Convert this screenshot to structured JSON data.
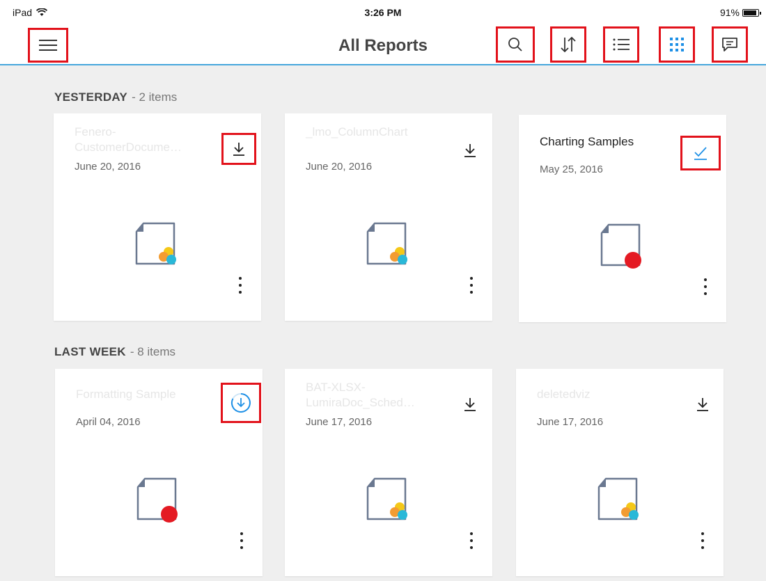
{
  "status_bar": {
    "device": "iPad",
    "time": "3:26 PM",
    "battery": "91%",
    "battery_level": 0.91
  },
  "nav": {
    "title": "All Reports"
  },
  "sections": [
    {
      "title": "YESTERDAY",
      "count": "- 2 items",
      "cards": [
        {
          "title": "Fenero-\nCustomerDocume…",
          "date": "June 20, 2016",
          "action": "download-icon",
          "doc": "multi-color"
        },
        {
          "title": "_lmo_ColumnChart",
          "date": "June 20, 2016",
          "action": "download-icon",
          "doc": "multi-color"
        },
        {
          "title": "Charting Samples",
          "date": "May 25, 2016",
          "action": "downloaded-check-icon",
          "doc": "red"
        }
      ]
    },
    {
      "title": "LAST WEEK",
      "count": "- 8 items",
      "cards": [
        {
          "title": "Formatting Sample",
          "date": "April 04, 2016",
          "action": "downloading-progress-icon",
          "doc": "red"
        },
        {
          "title": "BAT-XLSX-\nLumiraDoc_Sched…",
          "date": "June 17, 2016",
          "action": "download-icon",
          "doc": "multi-color"
        },
        {
          "title": "deletedviz",
          "date": "June 17, 2016",
          "action": "download-icon",
          "doc": "multi-color"
        }
      ]
    }
  ],
  "colors": {
    "accent": "#45a6dc",
    "highlight": "#e2121b",
    "orange": "#f39c32",
    "yellow": "#f5c818",
    "cyan": "#29b8d8",
    "red": "#e41a23"
  }
}
